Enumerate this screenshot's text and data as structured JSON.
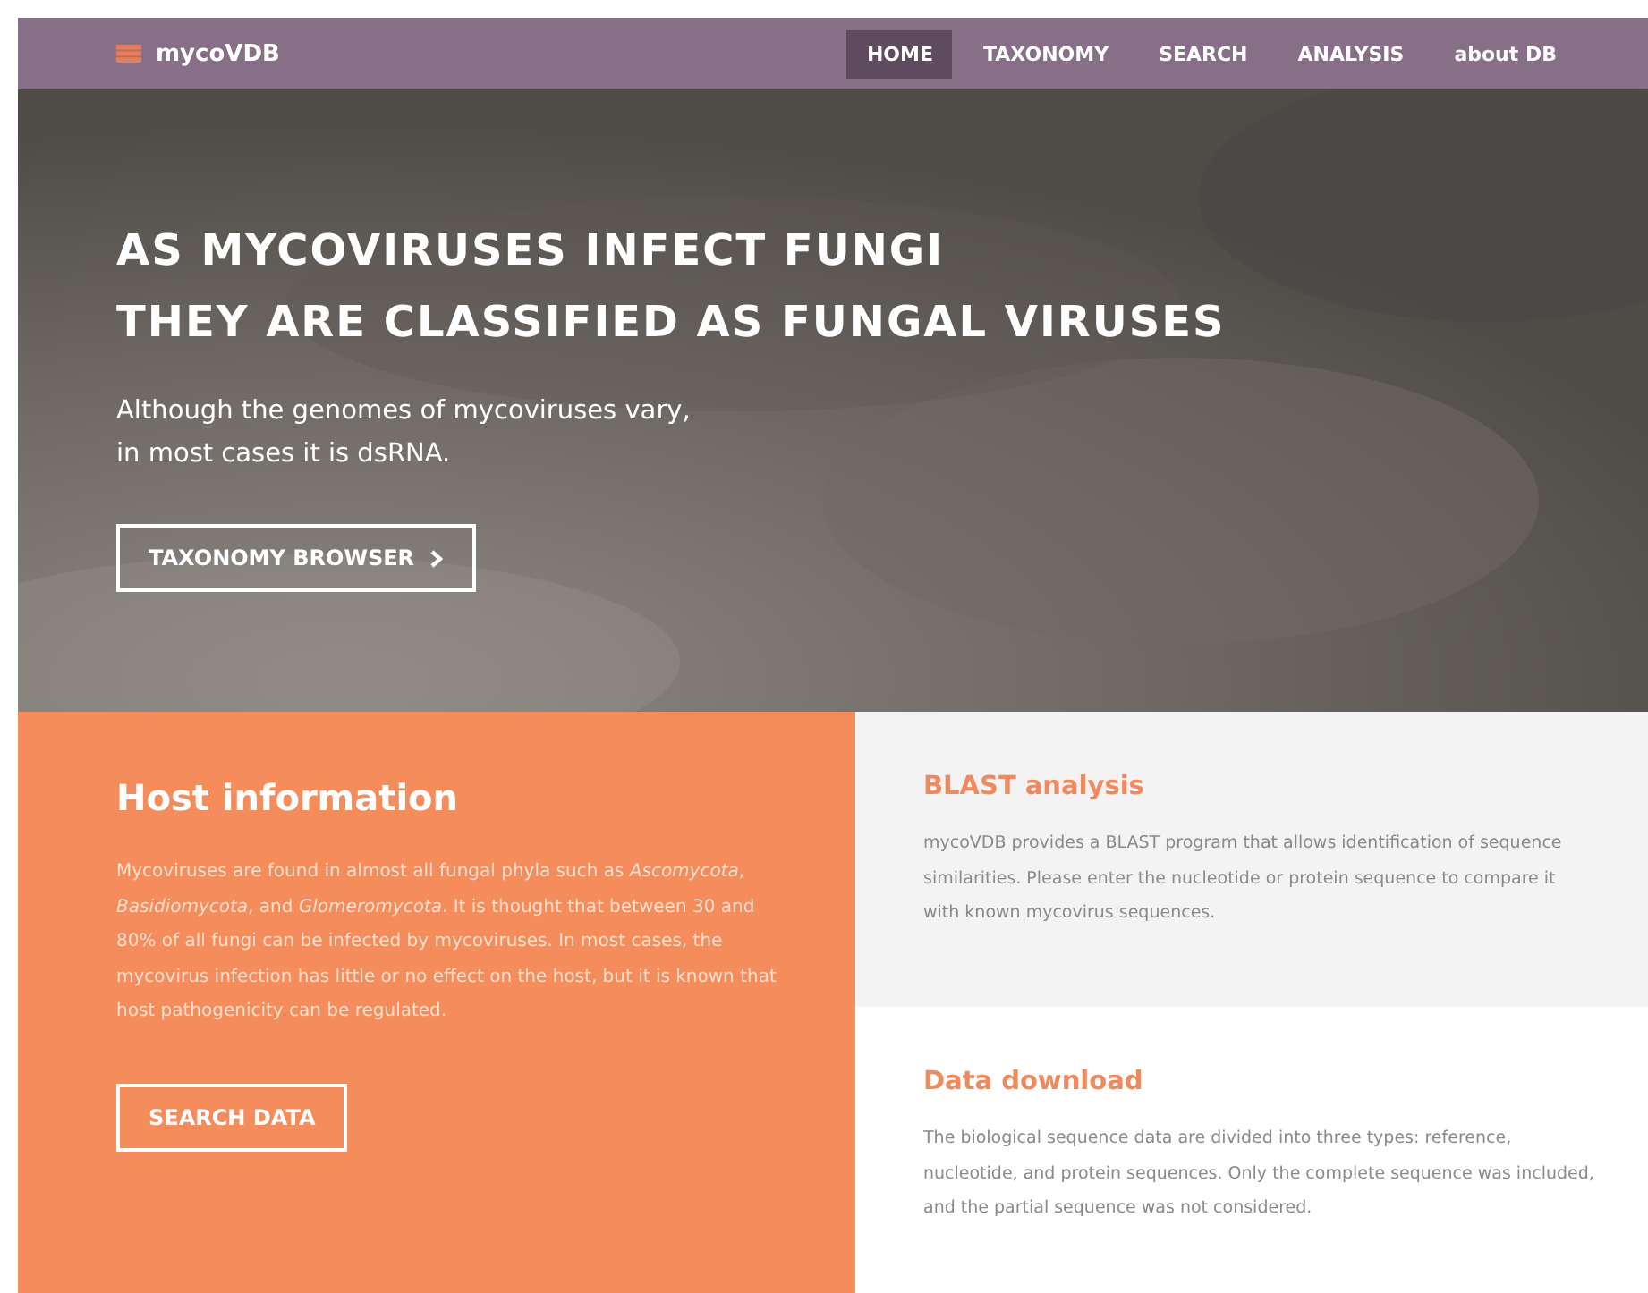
{
  "navbar": {
    "brand": "mycoVDB",
    "items": [
      {
        "label": "HOME",
        "selected": true
      },
      {
        "label": "TAXONOMY",
        "selected": false
      },
      {
        "label": "SEARCH",
        "selected": false
      },
      {
        "label": "ANALYSIS",
        "selected": false
      },
      {
        "label": "about DB",
        "selected": false
      }
    ]
  },
  "hero": {
    "title_lines": [
      "AS MYCOVIRUSES INFECT FUNGI",
      "THEY ARE CLASSIFIED AS FUNGAL VIRUSES"
    ],
    "subtitle_lines": [
      "Although the genomes of mycoviruses vary,",
      "in most cases it is dsRNA."
    ],
    "button": "TAXONOMY BROWSER"
  },
  "host_panel": {
    "title": "Host information",
    "text": "Mycoviruses are found in almost all fungal phyla such as *Ascomycota*, *Basidiomycota*, and *Glomeromycota*. It is thought that between 30 and 80% of all fungi can be infected by mycoviruses. In most cases, the mycovirus infection has little or no effect on the host, but it is known that host pathogenicity can be regulated.",
    "button": "SEARCH DATA"
  },
  "info_panels": [
    {
      "title": "BLAST analysis",
      "text": "mycoVDB provides a BLAST program that allows identification of sequence similarities. Please enter the nucleotide or protein sequence to compare it with known mycovirus sequences.",
      "shaded": true
    },
    {
      "title": "Data download",
      "text": "The biological sequence data are divided into three types: reference, nucleotide, and protein sequences. Only the complete sequence was included, and the partial sequence was not considered.",
      "shaded": false
    }
  ]
}
